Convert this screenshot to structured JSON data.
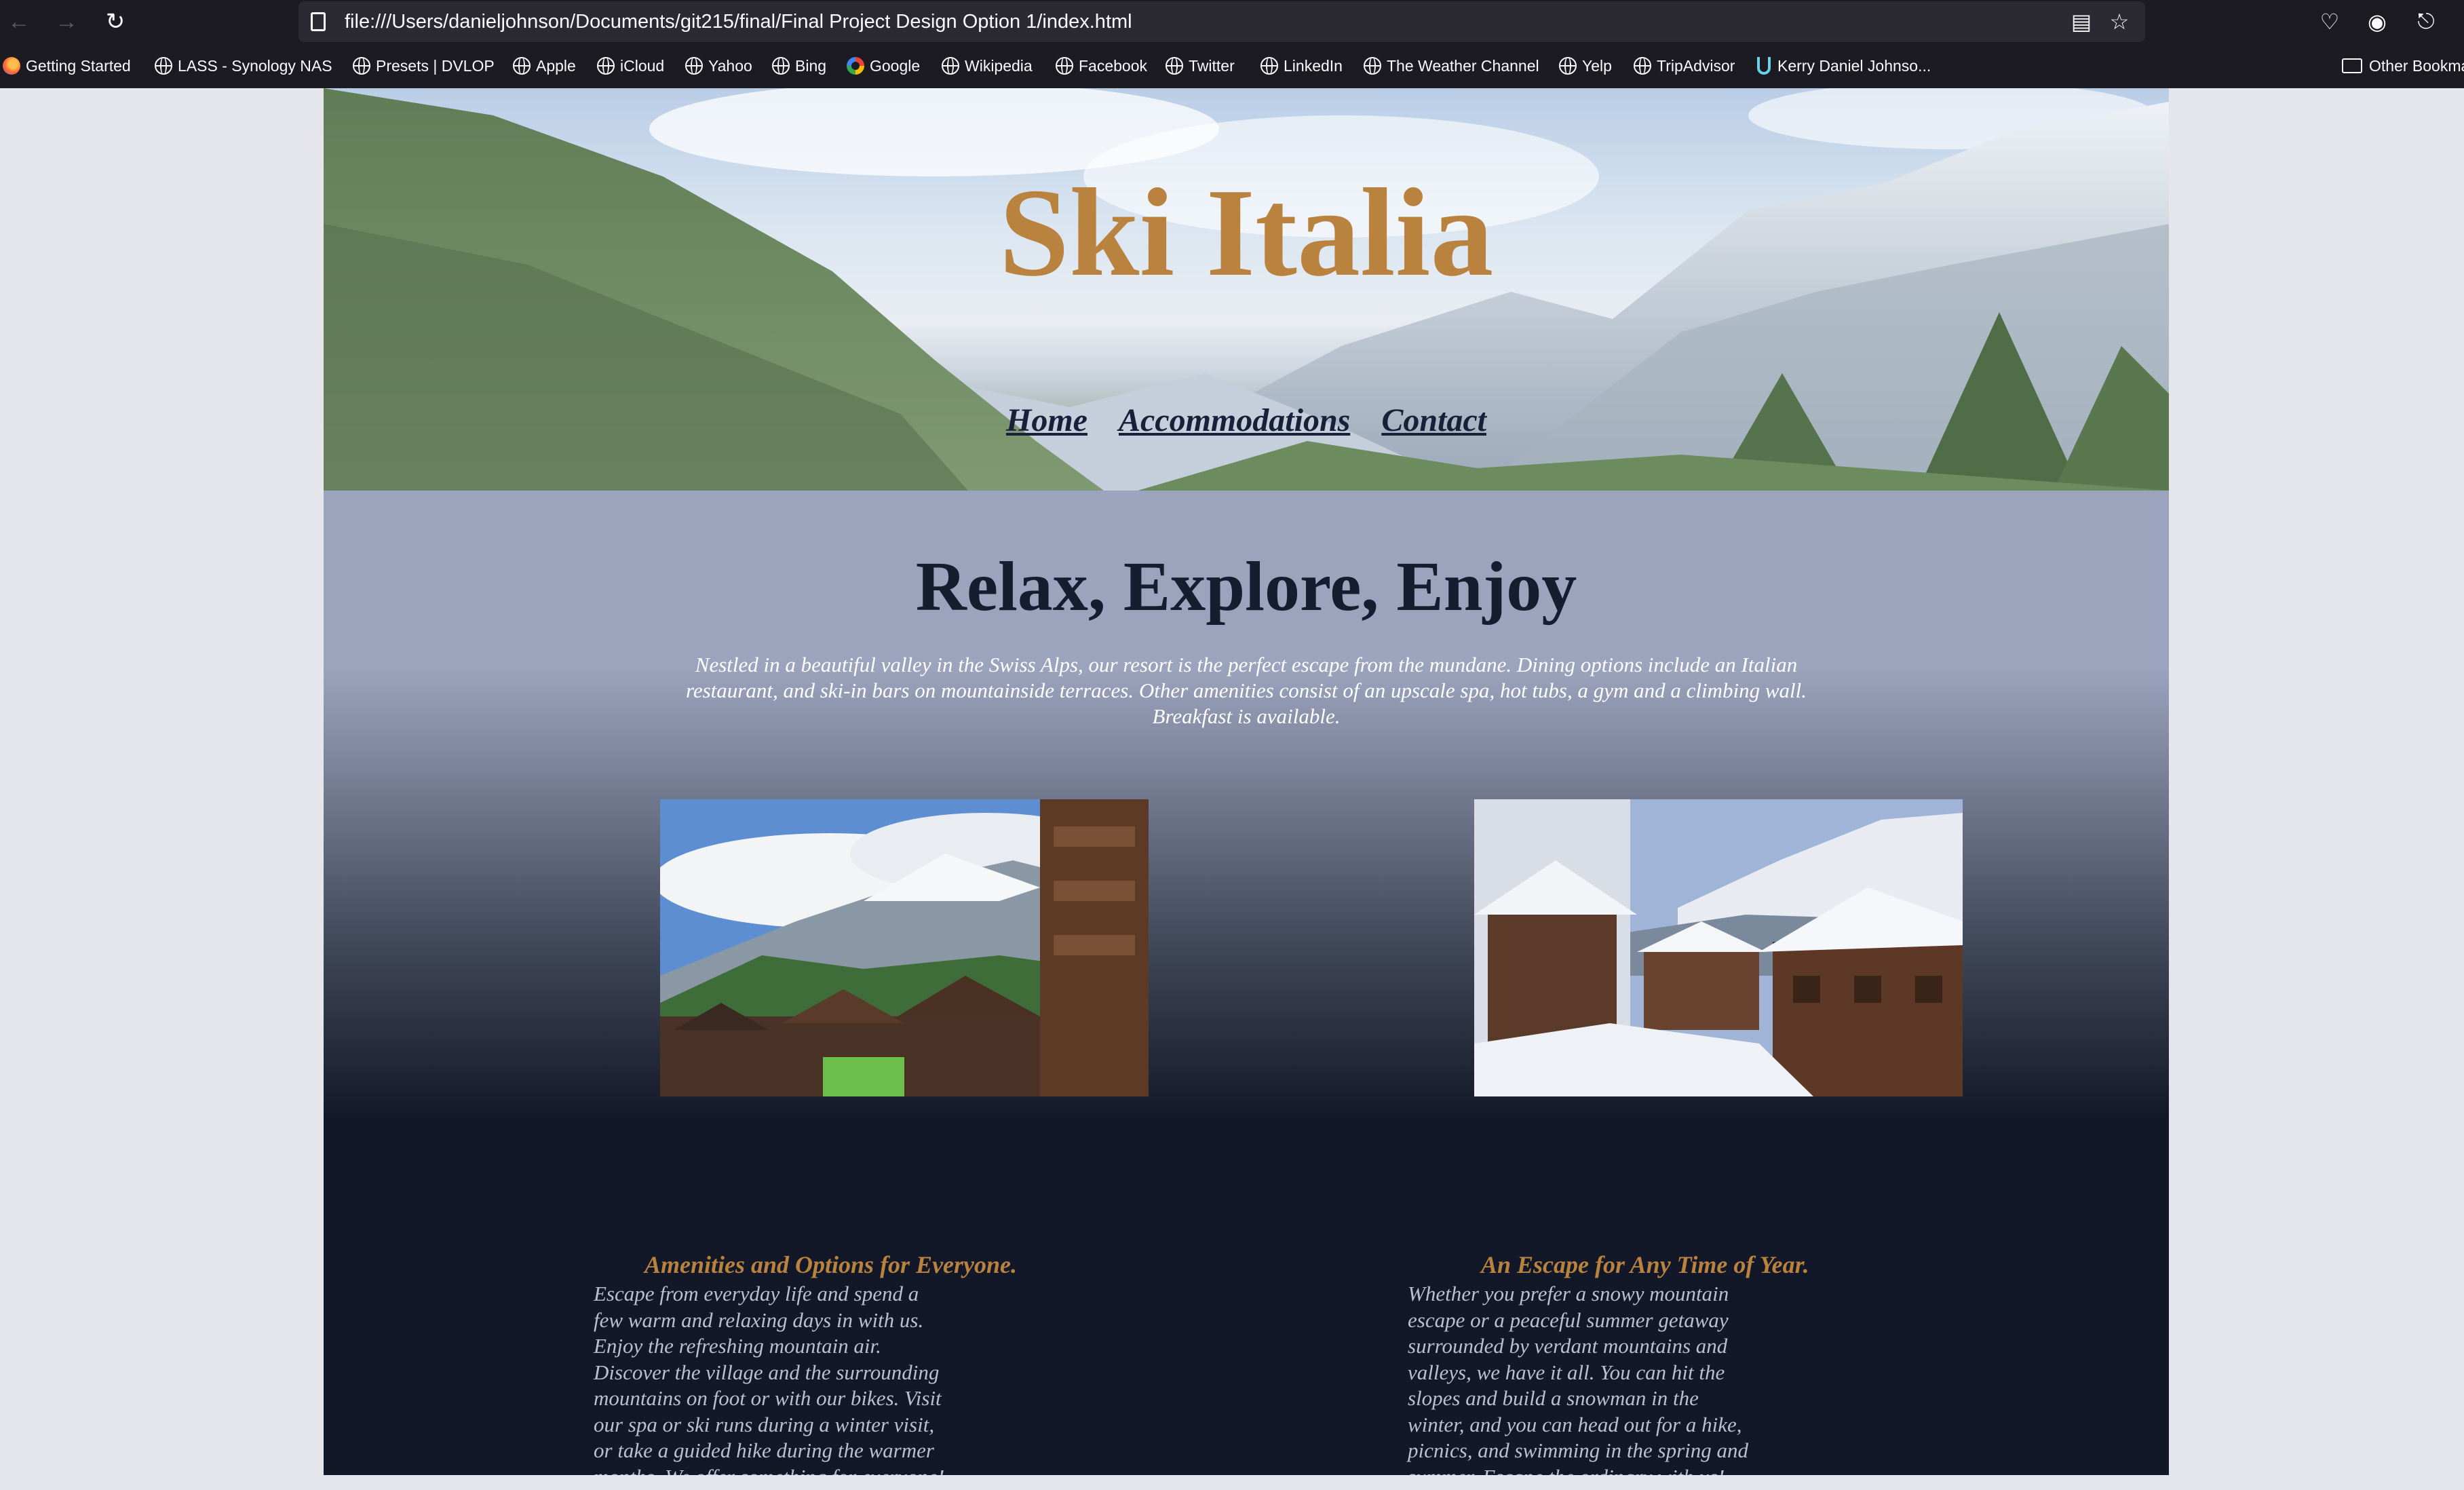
{
  "browser": {
    "url": "file:///Users/danieljohnson/Documents/git215/final/Final Project Design Option 1/index.html",
    "bookmarks": [
      {
        "label": "Getting Started",
        "icon": "firefox-icon"
      },
      {
        "label": "LASS - Synology NAS",
        "icon": "globe-icon"
      },
      {
        "label": "Presets | DVLOP",
        "icon": "globe-icon"
      },
      {
        "label": "Apple",
        "icon": "globe-icon"
      },
      {
        "label": "iCloud",
        "icon": "globe-icon"
      },
      {
        "label": "Yahoo",
        "icon": "globe-icon"
      },
      {
        "label": "Bing",
        "icon": "globe-icon"
      },
      {
        "label": "Google",
        "icon": "google-icon"
      },
      {
        "label": "Wikipedia",
        "icon": "globe-icon"
      },
      {
        "label": "Facebook",
        "icon": "globe-icon"
      },
      {
        "label": "Twitter",
        "icon": "globe-icon"
      },
      {
        "label": "LinkedIn",
        "icon": "globe-icon"
      },
      {
        "label": "The Weather Channel",
        "icon": "globe-icon"
      },
      {
        "label": "Yelp",
        "icon": "globe-icon"
      },
      {
        "label": "TripAdvisor",
        "icon": "globe-icon"
      },
      {
        "label": "Kerry Daniel Johnso...",
        "icon": "horseshoe-icon"
      }
    ],
    "other_bookmarks": "Other Bookma"
  },
  "site": {
    "title": "Ski Italia",
    "nav": [
      "Home",
      "Accommodations",
      "Contact"
    ],
    "headline": "Relax, Explore, Enjoy",
    "intro": "Nestled in a beautiful valley in the Swiss Alps, our resort is the perfect escape from the mundane. Dining options include an Italian restaurant, and ski-in bars on mountainside terraces. Other amenities consist of an upscale spa, hot tubs, a gym and a climbing wall. Breakfast is available.",
    "columns": [
      {
        "title": "Amenities and Options for Everyone.",
        "text": "Escape from everyday life and spend a few warm and relaxing days in with us. Enjoy the refreshing mountain air. Discover the village and the surrounding mountains on foot or with our bikes. Visit our spa or ski runs during a winter visit, or take a guided hike during the warmer months. We offer something for everyone!"
      },
      {
        "title": "An Escape for Any Time of Year.",
        "text": "Whether you prefer a snowy mountain escape or a peaceful summer getaway surrounded by verdant mountains and valleys, we have it all. You can hit the slopes and build a snowman in the winter, and you can head out for a hike, picnics, and swimming in the spring and summer. Escape the ordinary with us!"
      }
    ]
  },
  "colors": {
    "accent_gold": "#b9833f",
    "nav_navy": "#17223a",
    "dark_bg": "#121827",
    "mid_band": "#9ca3bd"
  }
}
